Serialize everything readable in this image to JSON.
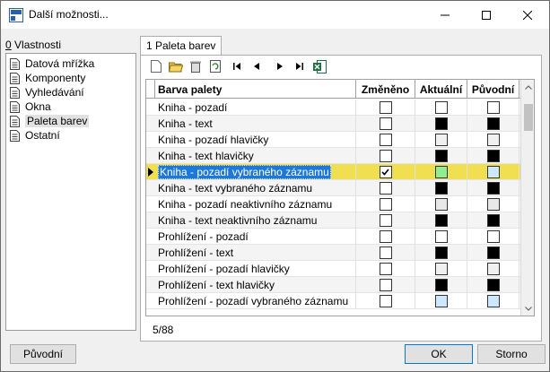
{
  "window": {
    "title": "Další možnosti..."
  },
  "left": {
    "label_mnemonic": "0",
    "label_rest": " Vlastnosti",
    "items": [
      {
        "label": "Datová mřížka"
      },
      {
        "label": "Komponenty"
      },
      {
        "label": "Vyhledávání"
      },
      {
        "label": "Okna"
      },
      {
        "label": "Paleta barev"
      },
      {
        "label": "Ostatní"
      }
    ],
    "selected_index": 4
  },
  "tab": {
    "label": "1 Paleta barev"
  },
  "grid": {
    "headers": {
      "name": "Barva palety",
      "changed": "Změněno",
      "current": "Aktuální",
      "original": "Původní"
    },
    "rows": [
      {
        "name": "Kniha - pozadí",
        "changed": false,
        "current": "#ffffff",
        "original": "#ffffff"
      },
      {
        "name": "Kniha - text",
        "changed": false,
        "current": "#000000",
        "original": "#000000"
      },
      {
        "name": "Kniha - pozadí hlavičky",
        "changed": false,
        "current": "#f0f0f0",
        "original": "#f0f0f0"
      },
      {
        "name": "Kniha - text hlavičky",
        "changed": false,
        "current": "#000000",
        "original": "#000000"
      },
      {
        "name": "Kniha - pozadí vybraného záznamu",
        "changed": true,
        "current": "#90ee90",
        "original": "#cce8ff"
      },
      {
        "name": "Kniha - text vybraného záznamu",
        "changed": false,
        "current": "#000000",
        "original": "#000000"
      },
      {
        "name": "Kniha - pozadí neaktivního záznamu",
        "changed": false,
        "current": "#e8e8e8",
        "original": "#e8e8e8"
      },
      {
        "name": "Kniha - text neaktivního záznamu",
        "changed": false,
        "current": "#000000",
        "original": "#000000"
      },
      {
        "name": "Prohlížení - pozadí",
        "changed": false,
        "current": "#ffffff",
        "original": "#ffffff"
      },
      {
        "name": "Prohlížení - text",
        "changed": false,
        "current": "#000000",
        "original": "#000000"
      },
      {
        "name": "Prohlížení - pozadí hlavičky",
        "changed": false,
        "current": "#f0f0f0",
        "original": "#f0f0f0"
      },
      {
        "name": "Prohlížení - text hlavičky",
        "changed": false,
        "current": "#000000",
        "original": "#000000"
      },
      {
        "name": "Prohlížení - pozadí vybraného záznamu",
        "changed": false,
        "current": "#cce8ff",
        "original": "#cce8ff"
      }
    ],
    "current_index": 4
  },
  "status": {
    "record": "5/88"
  },
  "buttons": {
    "original": "Původní",
    "ok": "OK",
    "cancel": "Storno"
  }
}
